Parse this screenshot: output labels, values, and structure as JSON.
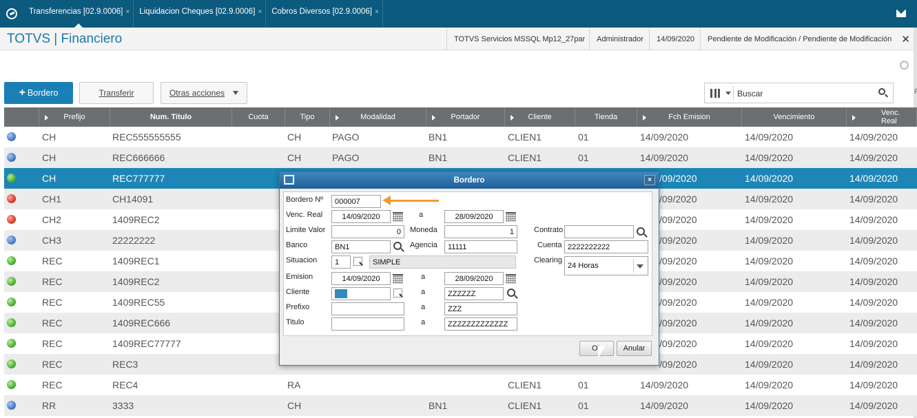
{
  "tabs": [
    {
      "label": "Transferencias [02.9.0006]",
      "active": true
    },
    {
      "label": "Liquidacion Cheques [02.9.0006]",
      "active": false
    },
    {
      "label": "Cobros Diversos [02.9.0006]",
      "active": false
    }
  ],
  "tab_close": "×",
  "header": {
    "title": "TOTVS | Financiero",
    "server": "TOTVS Servicios MSSQL Mp12_27par",
    "user": "Administrador",
    "date": "14/09/2020",
    "status": "Pendiente de Modificación / Pendiente de Modificación",
    "close": "✕"
  },
  "toolbar": {
    "bordero_label": "Bordero",
    "plus": "+",
    "transferir_label": "Transferir",
    "otras_label": "Otras acciones",
    "search_text": "Buscar",
    "edge_text": "F"
  },
  "grid": {
    "columns": [
      "Prefijo",
      "Num. Titulo",
      "Cuota",
      "Tipo",
      "Modalidad",
      "Portador",
      "Cliente",
      "Tienda",
      "Fch Emision",
      "Vencimiento",
      "Venc. Real"
    ],
    "rows": [
      {
        "status": "blue",
        "prefijo": "CH",
        "num": "REC555555555",
        "tipo": "CH",
        "modalidad": "PAGO",
        "portador": "BN1",
        "cliente": "CLIEN1",
        "tienda": "01",
        "emision": "14/09/2020",
        "venc": "14/09/2020",
        "vreal": "14/09/2020"
      },
      {
        "status": "blue",
        "prefijo": "CH",
        "num": "REC666666",
        "tipo": "CH",
        "modalidad": "PAGO",
        "portador": "BN1",
        "cliente": "CLIEN1",
        "tienda": "01",
        "emision": "14/09/2020",
        "venc": "14/09/2020",
        "vreal": "14/09/2020"
      },
      {
        "status": "green",
        "prefijo": "CH",
        "num": "REC777777",
        "tipo": "",
        "modalidad": "",
        "portador": "",
        "cliente": "",
        "tienda": "",
        "emision": "/09/2020",
        "venc": "14/09/2020",
        "vreal": "14/09/2020",
        "selected": true
      },
      {
        "status": "red",
        "prefijo": "CH1",
        "num": "CH14091",
        "tipo": "",
        "modalidad": "",
        "portador": "",
        "cliente": "",
        "tienda": "",
        "emision": "/09/2020",
        "venc": "14/09/2020",
        "vreal": "14/09/2020"
      },
      {
        "status": "red",
        "prefijo": "CH2",
        "num": "1409REC2",
        "tipo": "",
        "modalidad": "",
        "portador": "",
        "cliente": "",
        "tienda": "",
        "emision": "/09/2020",
        "venc": "14/09/2020",
        "vreal": "14/09/2020"
      },
      {
        "status": "blue",
        "prefijo": "CH3",
        "num": "22222222",
        "tipo": "",
        "modalidad": "",
        "portador": "",
        "cliente": "",
        "tienda": "",
        "emision": "/09/2020",
        "venc": "14/09/2020",
        "vreal": "14/09/2020"
      },
      {
        "status": "green",
        "prefijo": "REC",
        "num": "1409REC1",
        "tipo": "",
        "modalidad": "",
        "portador": "",
        "cliente": "",
        "tienda": "",
        "emision": "/09/2020",
        "venc": "14/09/2020",
        "vreal": "14/09/2020"
      },
      {
        "status": "green",
        "prefijo": "REC",
        "num": "1409REC2",
        "tipo": "",
        "modalidad": "",
        "portador": "",
        "cliente": "",
        "tienda": "",
        "emision": "/09/2020",
        "venc": "14/09/2020",
        "vreal": "14/09/2020"
      },
      {
        "status": "green",
        "prefijo": "REC",
        "num": "1409REC55",
        "tipo": "",
        "modalidad": "",
        "portador": "",
        "cliente": "",
        "tienda": "",
        "emision": "/09/2020",
        "venc": "14/09/2020",
        "vreal": "14/09/2020"
      },
      {
        "status": "green",
        "prefijo": "REC",
        "num": "1409REC666",
        "tipo": "",
        "modalidad": "",
        "portador": "",
        "cliente": "",
        "tienda": "",
        "emision": "/09/2020",
        "venc": "14/09/2020",
        "vreal": "14/09/2020"
      },
      {
        "status": "green",
        "prefijo": "REC",
        "num": "1409REC77777",
        "tipo": "",
        "modalidad": "",
        "portador": "",
        "cliente": "",
        "tienda": "",
        "emision": "/09/2020",
        "venc": "14/09/2020",
        "vreal": "14/09/2020"
      },
      {
        "status": "green",
        "prefijo": "REC",
        "num": "REC3",
        "tipo": "",
        "modalidad": "",
        "portador": "",
        "cliente": "",
        "tienda": "",
        "emision": "/09/2020",
        "venc": "14/09/2020",
        "vreal": "14/09/2020"
      },
      {
        "status": "green",
        "prefijo": "REC",
        "num": "REC4",
        "tipo": "RA",
        "modalidad": "",
        "portador": "",
        "cliente": "CLIEN1",
        "tienda": "01",
        "emision": "14/09/2020",
        "venc": "14/09/2020",
        "vreal": "14/09/2020"
      },
      {
        "status": "blue",
        "prefijo": "RR",
        "num": "3333",
        "tipo": "CH",
        "modalidad": "",
        "portador": "BN1",
        "cliente": "CLIEN1",
        "tienda": "01",
        "emision": "14/09/2020",
        "venc": "14/09/2020",
        "vreal": "14/09/2020"
      }
    ]
  },
  "dialog": {
    "title": "Bordero",
    "close": "×",
    "labels": {
      "bordero_no": "Bordero Nº",
      "venc_real": "Venc. Real",
      "a": "a",
      "limite_valor": "Limite Valor",
      "moneda": "Moneda",
      "contrato": "Contrato",
      "banco": "Banco",
      "agencia": "Agencia",
      "cuenta": "Cuenta",
      "situacion": "Situacion",
      "clearing": "Clearing",
      "emision": "Emision",
      "cliente": "Cliente",
      "prefijo": "Prefixo",
      "titulo": "Titulo"
    },
    "values": {
      "bordero_no": "000007",
      "venc_real_from": "14/09/2020",
      "venc_real_to": "28/09/2020",
      "limite_valor": "0",
      "moneda": "1",
      "contrato": "",
      "banco": "BN1",
      "agencia": "11111",
      "cuenta": "2222222222",
      "situacion_code": "1",
      "situacion_desc": "SIMPLE",
      "clearing": "24 Horas",
      "emision_from": "14/09/2020",
      "emision_to": "28/09/2020",
      "cliente_from": "",
      "cliente_to": "ZZZZZZ",
      "prefijo_from": "",
      "prefijo_to": "ZZZ",
      "titulo_from": "",
      "titulo_to": "ZZZZZZZZZZZZZ"
    },
    "ok_label": "Ok",
    "anular_label": "Anular"
  },
  "colors": {
    "topbar": "#0c5a7e",
    "accent": "#1a7fb5",
    "selected_row": "#1d86b6",
    "annotation_arrow": "#f29a2e"
  }
}
